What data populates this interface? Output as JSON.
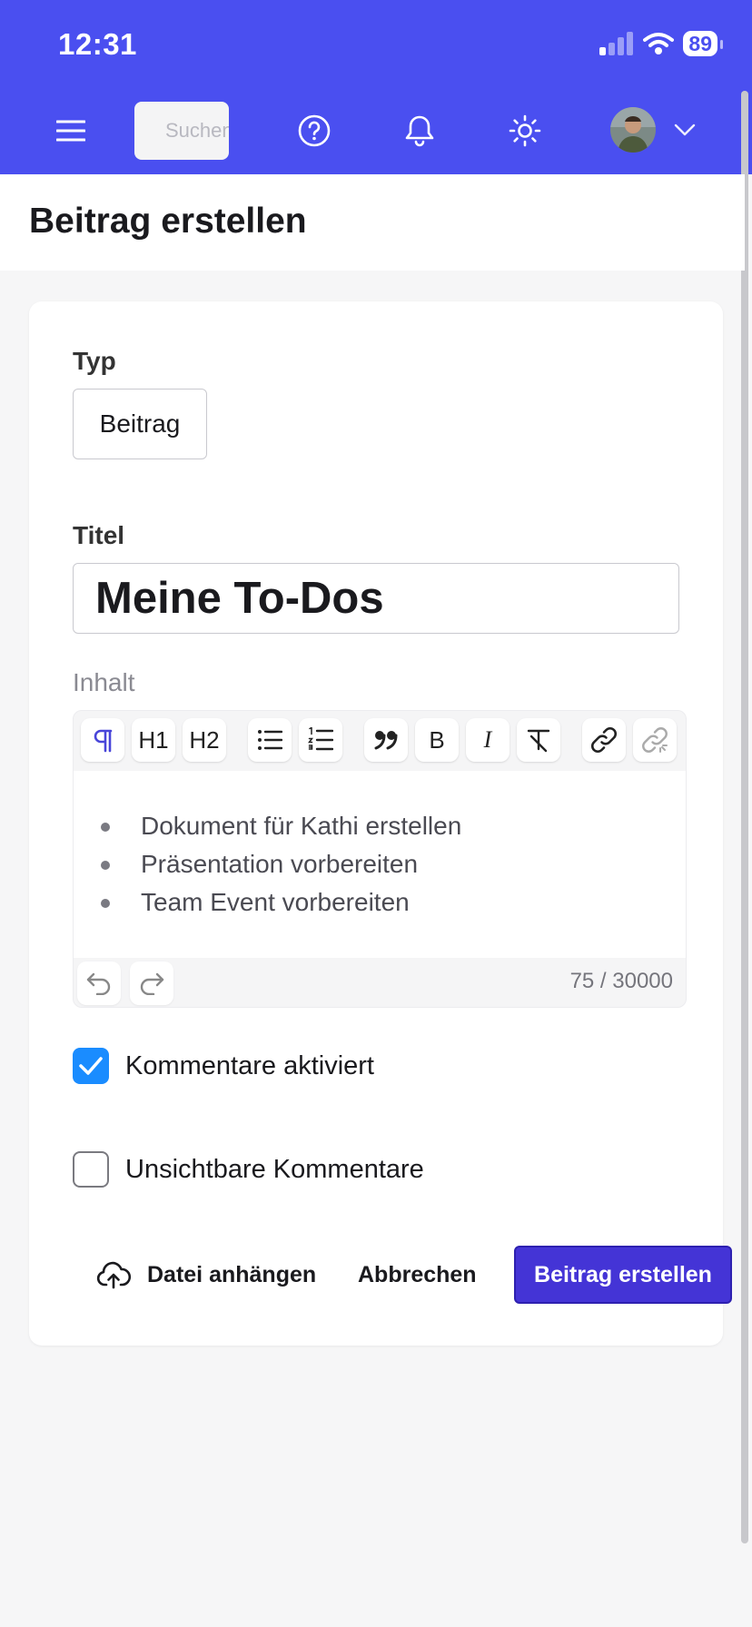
{
  "status_bar": {
    "time": "12:31",
    "battery": "89"
  },
  "header": {
    "search_placeholder": "Suchen",
    "icons": [
      "menu-icon",
      "search-icon",
      "help-icon",
      "bell-icon",
      "sun-icon",
      "avatar",
      "chevron-down-icon"
    ]
  },
  "page": {
    "title": "Beitrag erstellen"
  },
  "form": {
    "type_label": "Typ",
    "type_value": "Beitrag",
    "title_label": "Titel",
    "title_value": "Meine To-Dos",
    "content_label": "Inhalt",
    "toolbar_labels": {
      "h1": "H1",
      "h2": "H2",
      "bold": "B",
      "italic": "I"
    },
    "content_items": [
      "Dokument für Kathi erstellen",
      "Präsentation vorbereiten",
      "Team Event vorbereiten"
    ],
    "char_count": "75 / 30000",
    "comments_enabled": {
      "label": "Kommentare aktiviert",
      "checked": true
    },
    "invisible_comments": {
      "label": "Unsichtbare Kommentare",
      "checked": false
    }
  },
  "actions": {
    "attach": "Datei anhängen",
    "cancel": "Abbrechen",
    "submit": "Beitrag erstellen"
  },
  "colors": {
    "brand": "#4a4ff0",
    "primary_button": "#4434d6",
    "checkbox": "#1a8cff"
  }
}
